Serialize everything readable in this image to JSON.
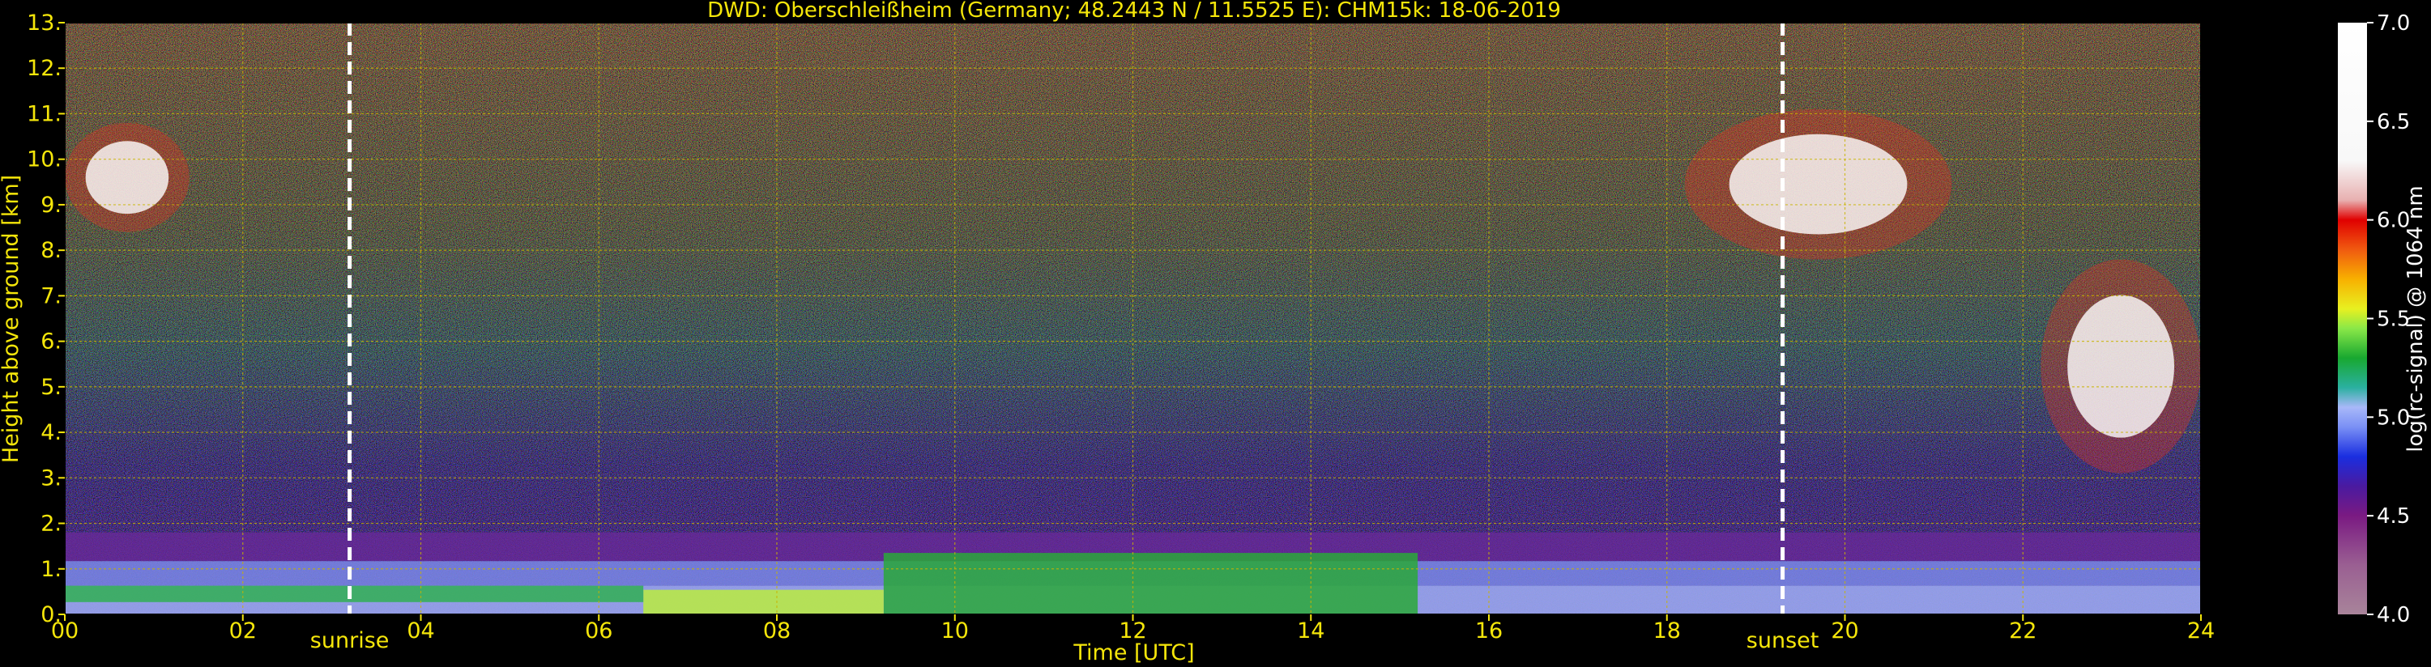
{
  "chart_data": {
    "type": "heatmap",
    "title": "DWD: Oberschleißheim (Germany; 48.2443 N / 11.5525 E):    CHM15k: 18-06-2019",
    "xlabel": "Time [UTC]",
    "ylabel": "Height above ground [km]",
    "x_unit": "hour UTC",
    "y_unit": "km",
    "xlim": [
      0,
      24
    ],
    "ylim": [
      0,
      13
    ],
    "x_ticks": [
      0,
      2,
      4,
      6,
      8,
      10,
      12,
      14,
      16,
      18,
      20,
      22,
      24
    ],
    "x_tick_labels": [
      "00",
      "02",
      "04",
      "06",
      "08",
      "10",
      "12",
      "14",
      "16",
      "18",
      "20",
      "22",
      "24"
    ],
    "y_ticks": [
      0,
      1,
      2,
      3,
      4,
      5,
      6,
      7,
      8,
      9,
      10,
      11,
      12,
      13
    ],
    "y_tick_labels": [
      "0.",
      "1.",
      "2.",
      "3.",
      "4.",
      "5.",
      "6.",
      "7.",
      "8.",
      "9.",
      "10.",
      "11.",
      "12.",
      "13."
    ],
    "grid": true,
    "grid_color": "#c8b400",
    "events": [
      {
        "label": "sunrise",
        "time": 3.2
      },
      {
        "label": "sunset",
        "time": 19.3
      }
    ],
    "colorbar": {
      "label": "log(rc-signal) @ 1064 nm",
      "range": [
        4.0,
        7.0
      ],
      "ticks": [
        4.0,
        4.5,
        5.0,
        5.5,
        6.0,
        6.5,
        7.0
      ],
      "tick_labels": [
        "4.0",
        "4.5",
        "5.0",
        "5.5",
        "6.0",
        "6.5",
        "7.0"
      ],
      "stops": [
        {
          "v": 4.0,
          "color": "#a8849a"
        },
        {
          "v": 4.25,
          "color": "#9a5f92"
        },
        {
          "v": 4.5,
          "color": "#7a1a82"
        },
        {
          "v": 4.65,
          "color": "#4a1aa0"
        },
        {
          "v": 4.8,
          "color": "#1a2ee0"
        },
        {
          "v": 4.95,
          "color": "#7a90f5"
        },
        {
          "v": 5.05,
          "color": "#a8b8f8"
        },
        {
          "v": 5.15,
          "color": "#2ab0a0"
        },
        {
          "v": 5.3,
          "color": "#18a830"
        },
        {
          "v": 5.45,
          "color": "#8ae848"
        },
        {
          "v": 5.55,
          "color": "#e8f020"
        },
        {
          "v": 5.7,
          "color": "#f8b000"
        },
        {
          "v": 5.85,
          "color": "#f05a10"
        },
        {
          "v": 6.0,
          "color": "#e00000"
        },
        {
          "v": 6.1,
          "color": "#e8b0b0"
        },
        {
          "v": 6.3,
          "color": "#f8f8f8"
        },
        {
          "v": 7.0,
          "color": "#ffffff"
        }
      ]
    },
    "features": [
      {
        "kind": "cloud",
        "t_start": 0.0,
        "t_end": 1.4,
        "h_bottom": 8.4,
        "h_top": 10.8
      },
      {
        "kind": "cloud",
        "t_start": 18.2,
        "t_end": 21.2,
        "h_bottom": 7.8,
        "h_top": 11.1
      },
      {
        "kind": "cloud",
        "t_start": 22.2,
        "t_end": 24.0,
        "h_bottom": 3.1,
        "h_top": 7.8
      },
      {
        "kind": "boundary_layer",
        "t_start": 0.0,
        "t_end": 24.0,
        "h_bottom": 0.0,
        "h_top": 1.8
      }
    ]
  }
}
